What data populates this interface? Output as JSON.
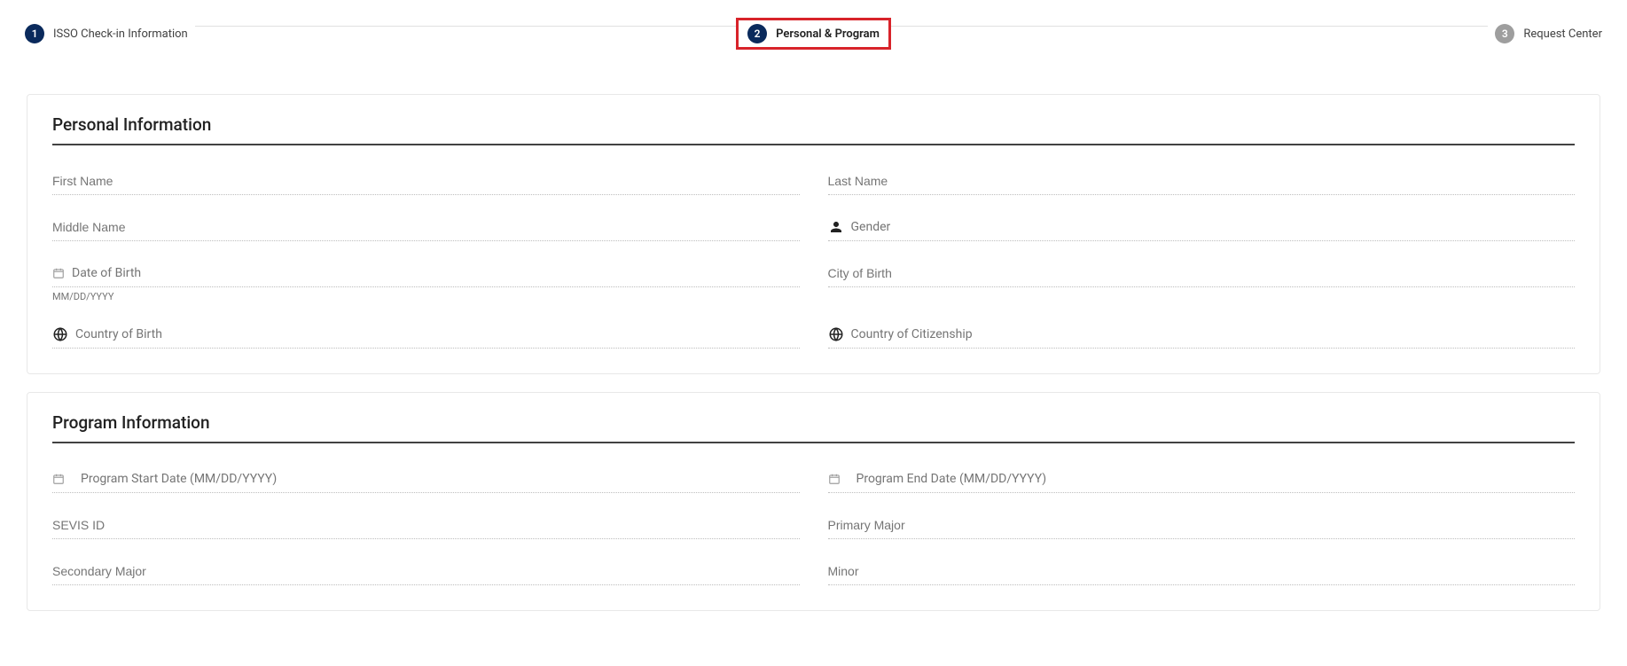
{
  "stepper": {
    "step1": {
      "number": "1",
      "label": "ISSO Check-in Information"
    },
    "step2": {
      "number": "2",
      "label": "Personal & Program"
    },
    "step3": {
      "number": "3",
      "label": "Request Center"
    }
  },
  "sections": {
    "personal": {
      "title": "Personal Information",
      "fields": {
        "firstName": "First Name",
        "lastName": "Last Name",
        "middleName": "Middle Name",
        "gender": "Gender",
        "dateOfBirth": "Date of Birth",
        "dateOfBirthHint": "MM/DD/YYYY",
        "cityOfBirth": "City of Birth",
        "countryOfBirth": "Country of Birth",
        "countryOfCitizenship": "Country of Citizenship"
      }
    },
    "program": {
      "title": "Program Information",
      "fields": {
        "programStartDate": "Program Start Date (MM/DD/YYYY)",
        "programEndDate": "Program End Date (MM/DD/YYYY)",
        "sevisId": "SEVIS ID",
        "primaryMajor": "Primary Major",
        "secondaryMajor": "Secondary Major",
        "minor": "Minor"
      }
    }
  }
}
